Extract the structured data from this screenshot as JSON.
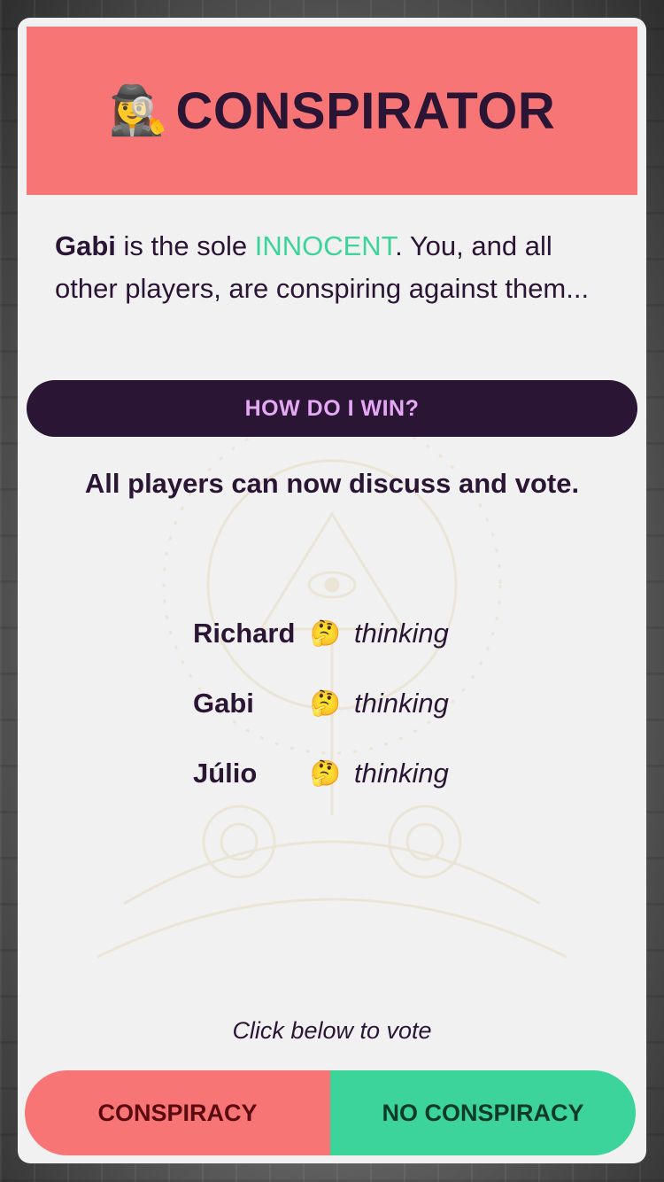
{
  "role": {
    "emoji": "🕵️‍♀️",
    "icon_name": "detective-icon",
    "title": "CONSPIRATOR",
    "color": "#f87575"
  },
  "intro": {
    "innocent_player": "Gabi",
    "text_before": " is the sole ",
    "innocent_label": "INNOCENT",
    "text_after": ". You, and all other players, are conspiring against them..."
  },
  "how_to_win_button": "HOW DO I WIN?",
  "status": "All players can now discuss and vote.",
  "players": [
    {
      "name": "Richard",
      "emoji": "🤔",
      "icon_name": "thinking-face-icon",
      "state": "thinking"
    },
    {
      "name": "Gabi",
      "emoji": "🤔",
      "icon_name": "thinking-face-icon",
      "state": "thinking"
    },
    {
      "name": "Júlio",
      "emoji": "🤔",
      "icon_name": "thinking-face-icon",
      "state": "thinking"
    }
  ],
  "vote": {
    "hint": "Click below to vote",
    "conspiracy_label": "CONSPIRACY",
    "no_conspiracy_label": "NO CONSPIRACY"
  },
  "colors": {
    "dark": "#2a1535",
    "red": "#f87575",
    "green": "#3cd49b",
    "button_text": "#e5a8f5",
    "card": "#f1f1f1"
  }
}
